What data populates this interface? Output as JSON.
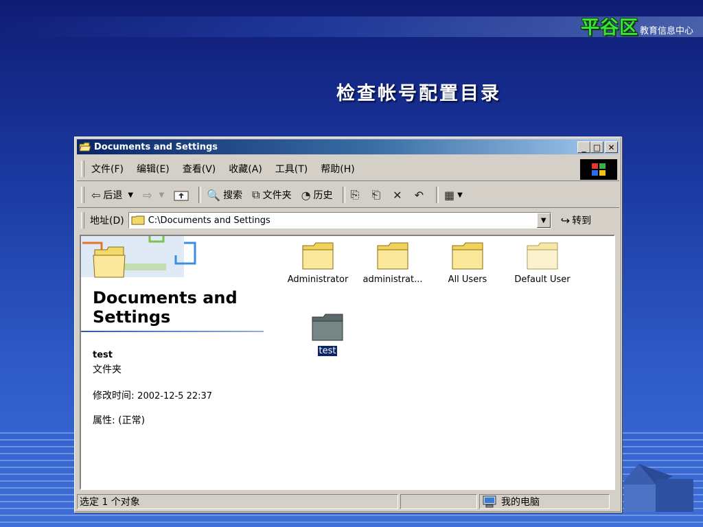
{
  "logo": {
    "main": "平谷区",
    "sub": "教育信息中心"
  },
  "slide": {
    "title": "检查帐号配置目录"
  },
  "window": {
    "title": "Documents and Settings",
    "buttons": {
      "minimize": "_",
      "maximize": "□",
      "close": "✕"
    }
  },
  "menubar": {
    "items": [
      "文件(F)",
      "编辑(E)",
      "查看(V)",
      "收藏(A)",
      "工具(T)",
      "帮助(H)"
    ]
  },
  "toolbar": {
    "back": "后退",
    "search": "搜索",
    "folders": "文件夹",
    "history": "历史"
  },
  "address": {
    "label": "地址(D)",
    "value": "C:\\Documents and Settings",
    "go": "转到"
  },
  "left_panel": {
    "title_line1": "Documents and",
    "title_line2": "Settings",
    "selected_name": "test",
    "selected_type": "文件夹",
    "modified_label": "修改时间:",
    "modified_value": "2002-12-5 22:37",
    "attr_label": "属性:",
    "attr_value": "(正常)"
  },
  "files": [
    {
      "name": "Administrator"
    },
    {
      "name": "administrat..."
    },
    {
      "name": "All Users"
    },
    {
      "name": "Default User"
    },
    {
      "name": "test"
    }
  ],
  "statusbar": {
    "selection": "选定 1 个对象",
    "zone": "我的电脑"
  }
}
